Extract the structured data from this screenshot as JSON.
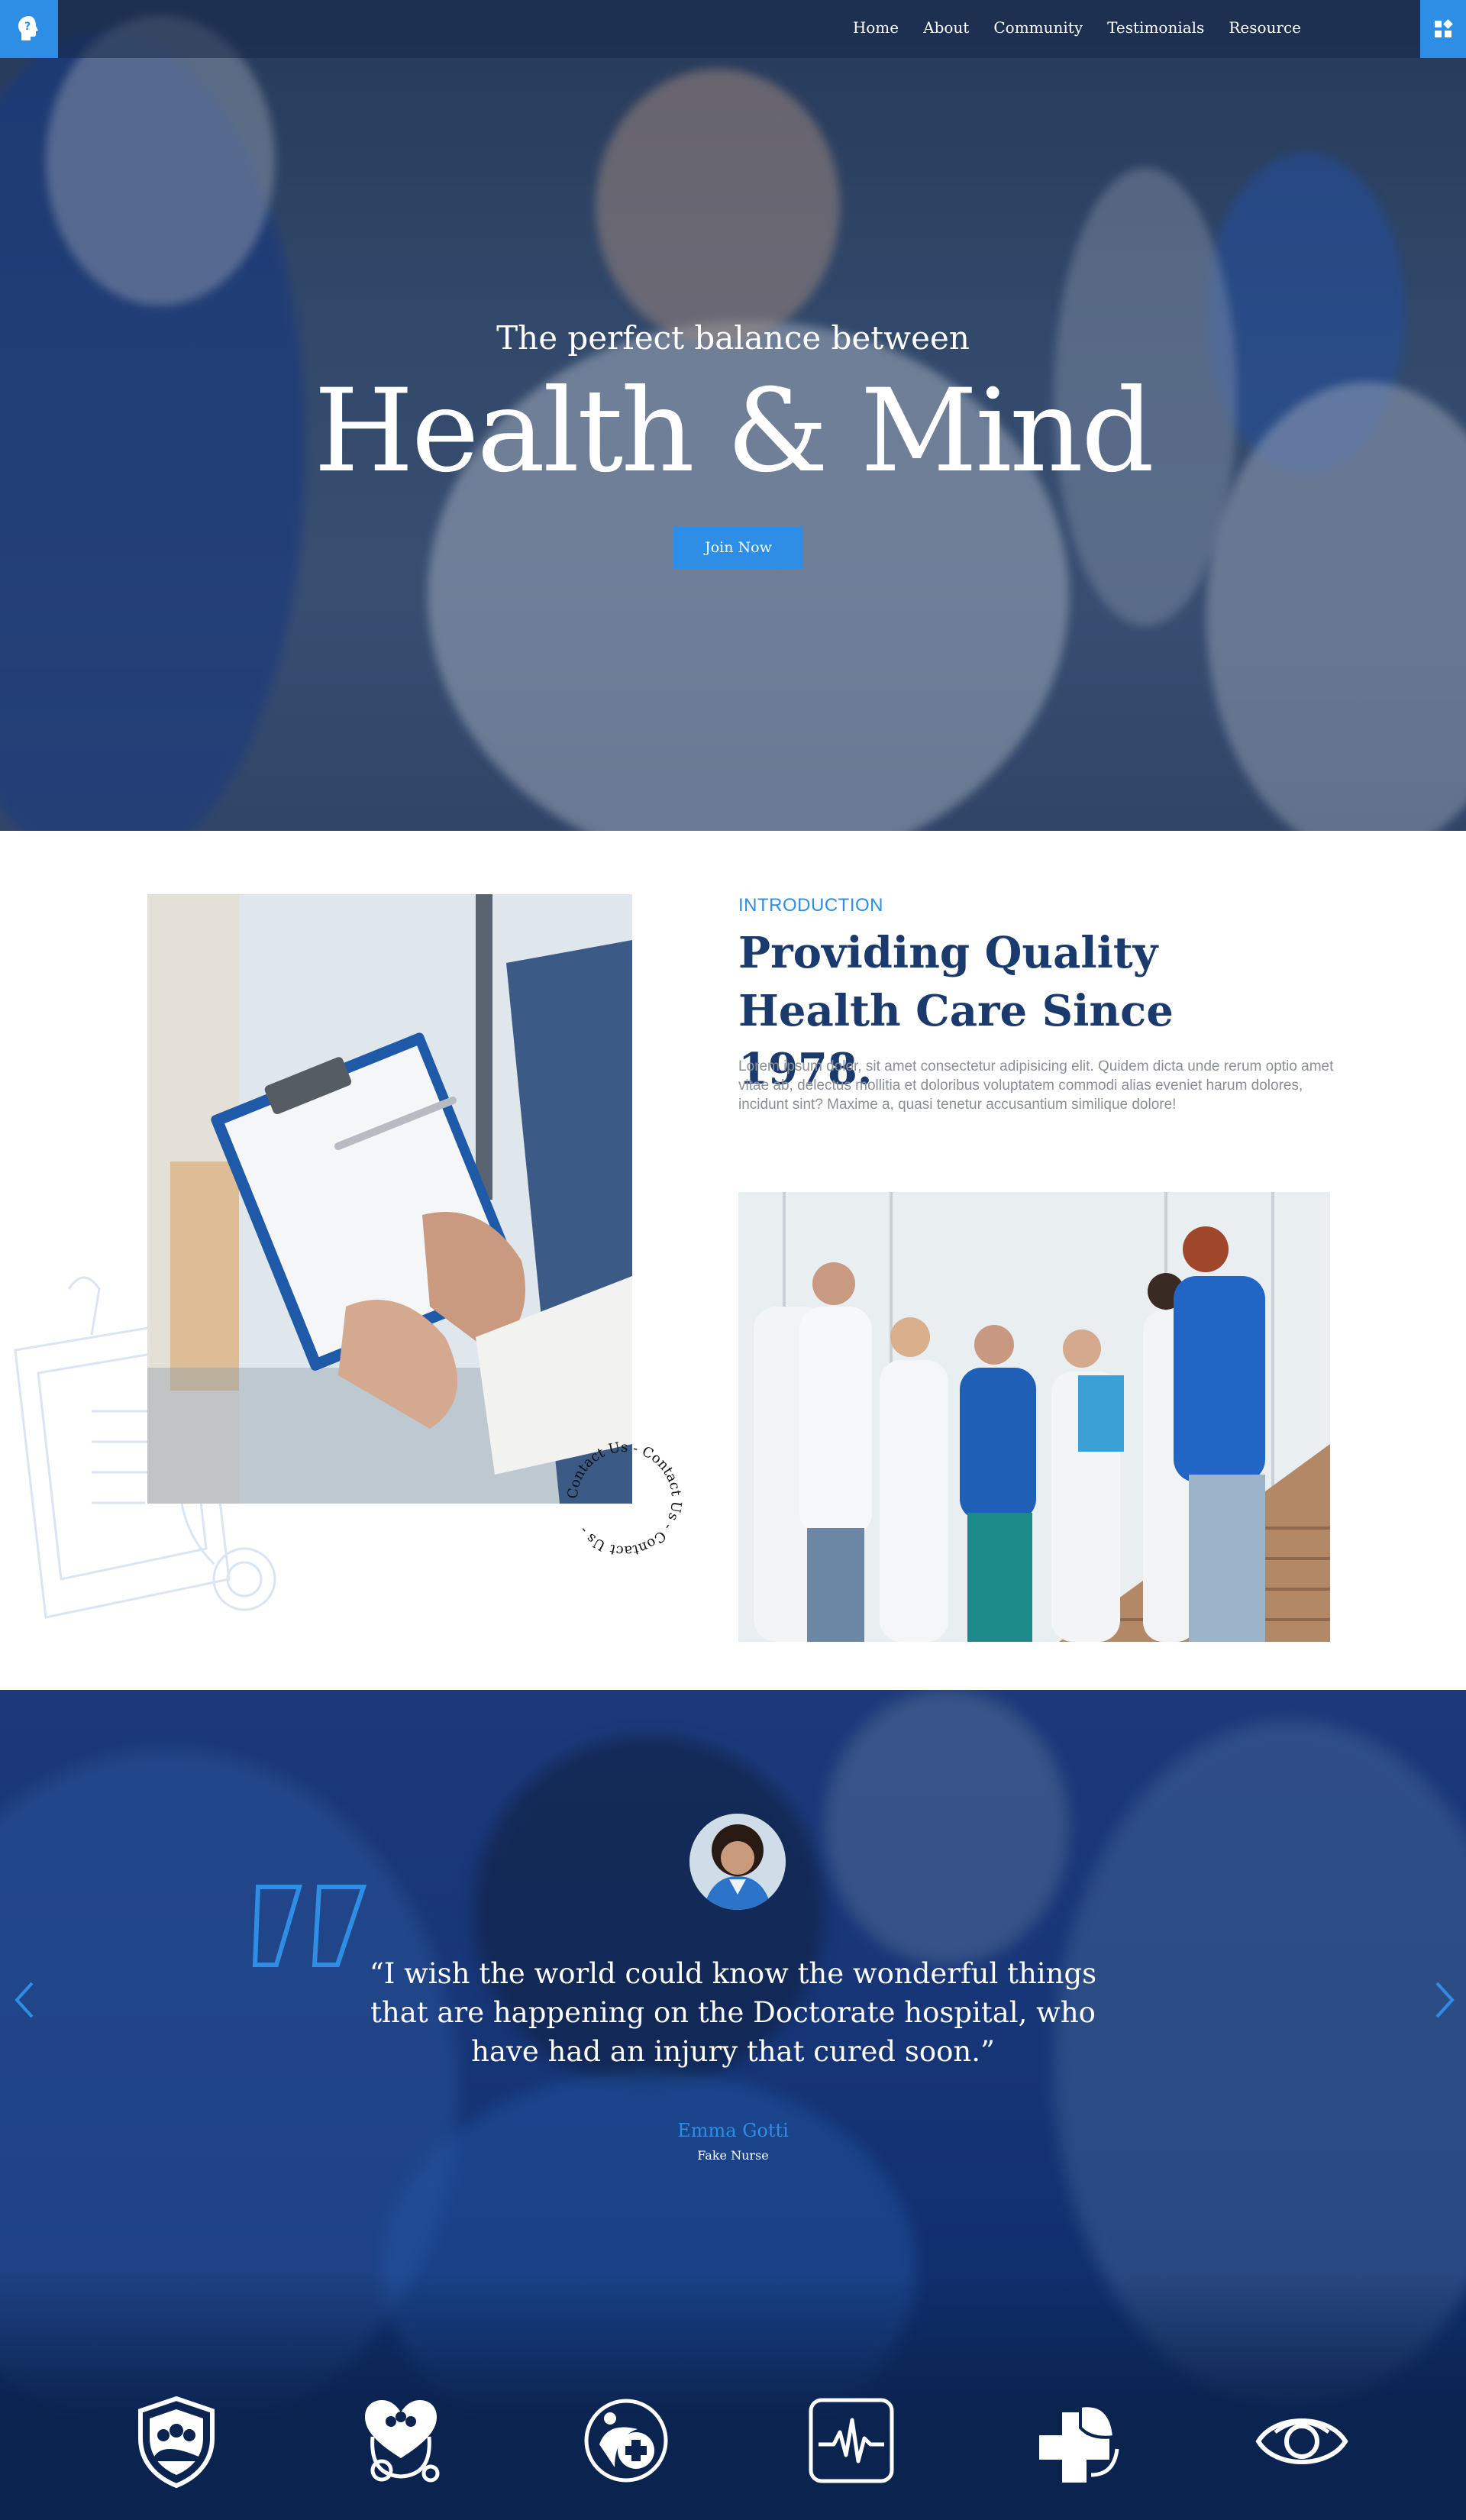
{
  "nav": {
    "items": [
      {
        "label": "Home"
      },
      {
        "label": "About"
      },
      {
        "label": "Community"
      },
      {
        "label": "Testimonials"
      },
      {
        "label": "Resource"
      }
    ]
  },
  "hero": {
    "subtitle": "The perfect balance between",
    "title": "Health & Mind",
    "cta_label": "Join Now"
  },
  "intro": {
    "kicker": "INTRODUCTION",
    "title": "Providing Quality Health Care Since 1978.",
    "body": "Lorem ipsum dolor, sit amet consectetur adipisicing elit. Quidem dicta unde rerum optio amet vitae ab, delectus mollitia et doloribus voluptatem commodi alias eveniet harum dolores, incidunt sint? Maxime a, quasi tenetur accusantium similique dolore!",
    "contact_ring_text": "Contact Us - Contact Us - Contact Us - "
  },
  "testimonial": {
    "quote": "“I wish the world could know the wonderful things that are happening on the Doctorate hospital, who have had an injury that cured soon.”",
    "author": "Emma Gotti",
    "role": "Fake Nurse"
  },
  "icons": [
    "shield-family-icon",
    "heart-stethoscope-icon",
    "health-person-cross-icon",
    "heartbeat-monitor-icon",
    "medical-cross-leaf-icon",
    "eye-icon"
  ],
  "colors": {
    "accent": "#2e8ee6",
    "navy": "#1a3a6e",
    "testimonial_bg": "#163577"
  }
}
